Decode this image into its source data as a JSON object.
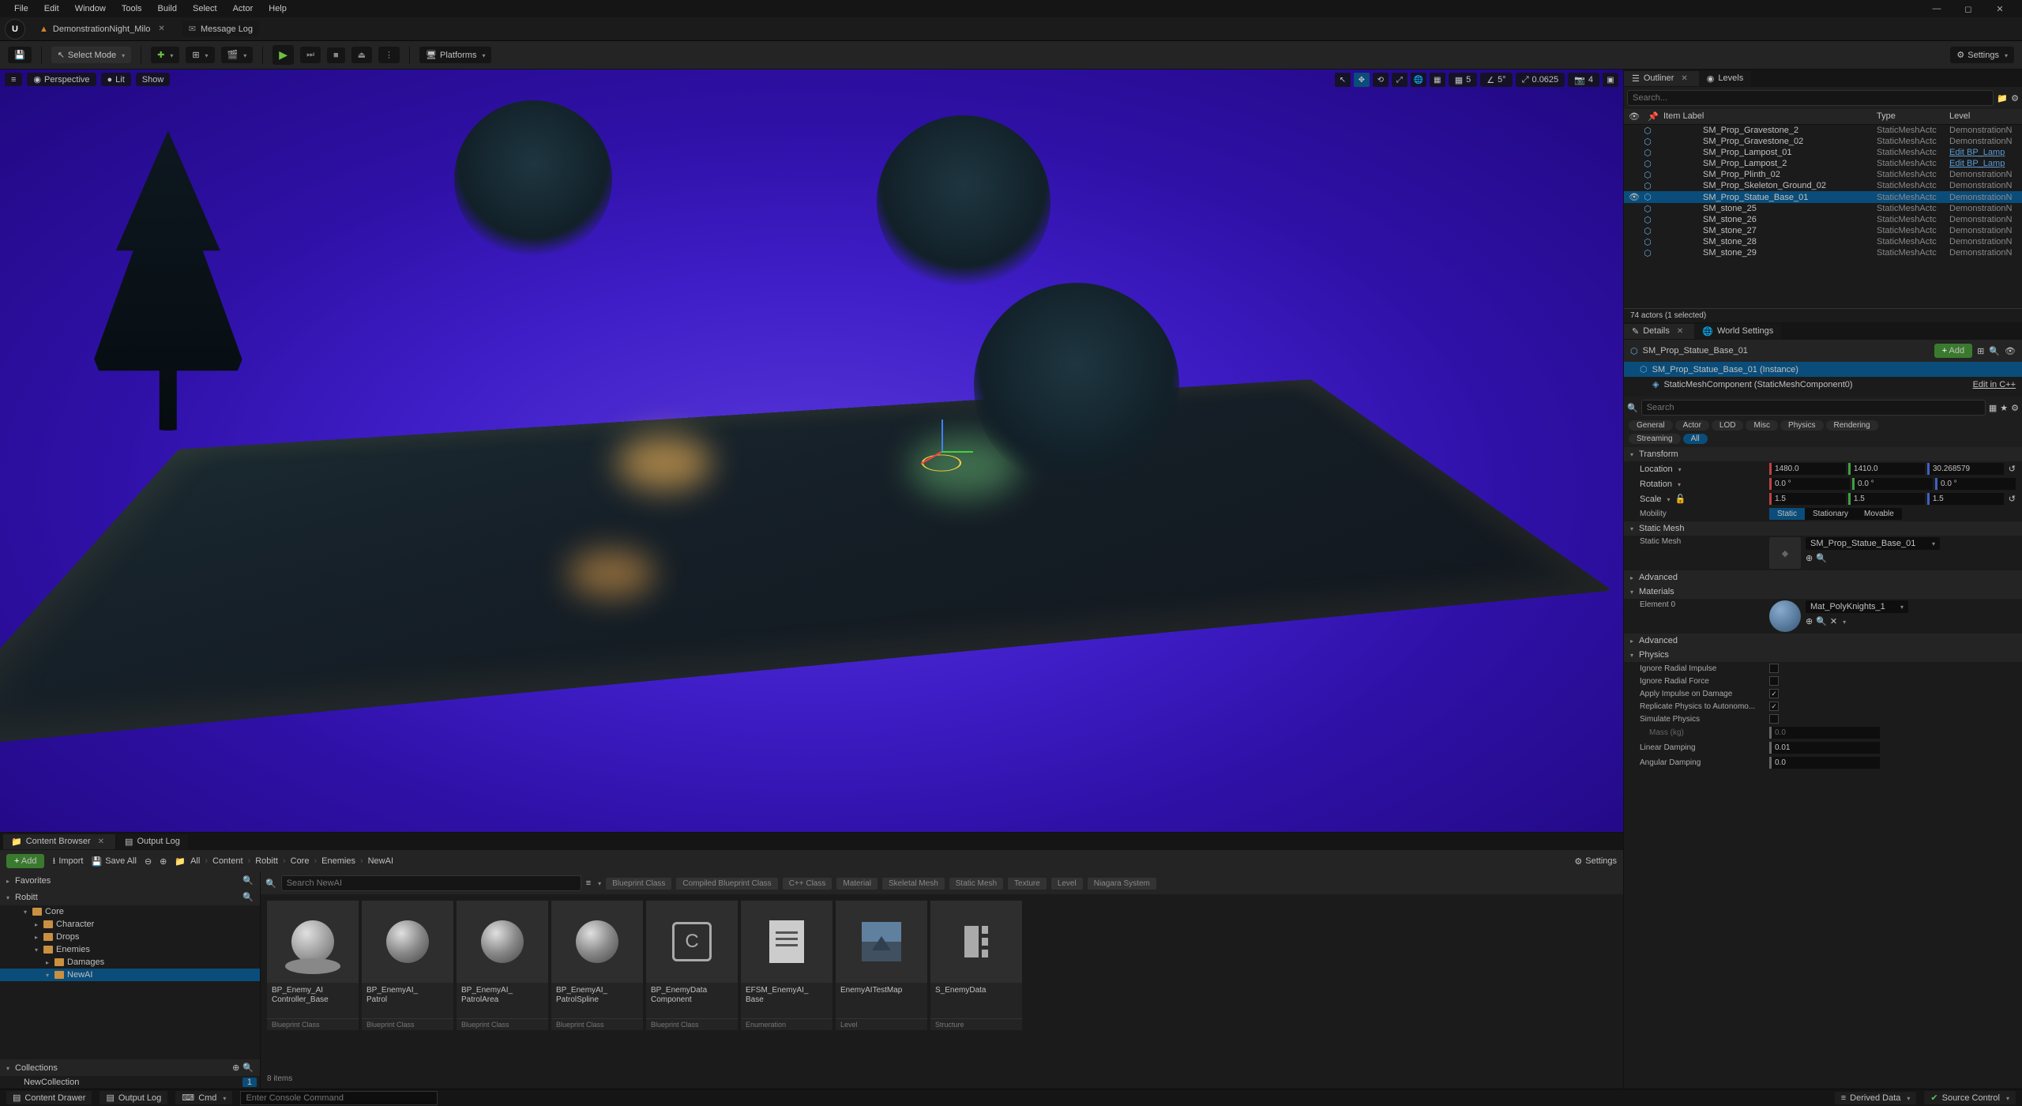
{
  "menu": [
    "File",
    "Edit",
    "Window",
    "Tools",
    "Build",
    "Select",
    "Actor",
    "Help"
  ],
  "level_tab": "DemonstrationNight_Milo",
  "msg_log_tab": "Message Log",
  "toolbar": {
    "select_mode": "Select Mode",
    "platforms": "Platforms",
    "settings": "Settings"
  },
  "viewport": {
    "menu_btn": "≡",
    "perspective": "Perspective",
    "lit": "Lit",
    "show": "Show",
    "snap_val": "5",
    "angle_val": "5°",
    "scale_val": "0.0625",
    "cam_val": "4"
  },
  "outliner": {
    "tab": "Outliner",
    "levels_tab": "Levels",
    "search_ph": "Search...",
    "cols": {
      "label": "Item Label",
      "type": "Type",
      "level": "Level"
    },
    "rows": [
      {
        "n": "SM_Prop_Gravestone_2",
        "t": "StaticMeshActc",
        "lv": "DemonstrationN"
      },
      {
        "n": "SM_Prop_Gravestone_02",
        "t": "StaticMeshActc",
        "lv": "DemonstrationN"
      },
      {
        "n": "SM_Prop_Lampost_01",
        "t": "StaticMeshActc",
        "lv": "Edit BP_Lamp",
        "link": true
      },
      {
        "n": "SM_Prop_Lampost_2",
        "t": "StaticMeshActc",
        "lv": "Edit BP_Lamp",
        "link": true
      },
      {
        "n": "SM_Prop_Plinth_02",
        "t": "StaticMeshActc",
        "lv": "DemonstrationN"
      },
      {
        "n": "SM_Prop_Skeleton_Ground_02",
        "t": "StaticMeshActc",
        "lv": "DemonstrationN"
      },
      {
        "n": "SM_Prop_Statue_Base_01",
        "t": "StaticMeshActc",
        "lv": "DemonstrationN",
        "sel": true
      },
      {
        "n": "SM_stone_25",
        "t": "StaticMeshActc",
        "lv": "DemonstrationN"
      },
      {
        "n": "SM_stone_26",
        "t": "StaticMeshActc",
        "lv": "DemonstrationN"
      },
      {
        "n": "SM_stone_27",
        "t": "StaticMeshActc",
        "lv": "DemonstrationN"
      },
      {
        "n": "SM_stone_28",
        "t": "StaticMeshActc",
        "lv": "DemonstrationN"
      },
      {
        "n": "SM_stone_29",
        "t": "StaticMeshActc",
        "lv": "DemonstrationN"
      }
    ],
    "status": "74 actors (1 selected)"
  },
  "details": {
    "tab": "Details",
    "world_tab": "World Settings",
    "actor": "SM_Prop_Statue_Base_01",
    "add": "Add",
    "instance": "SM_Prop_Statue_Base_01 (Instance)",
    "smc": "StaticMeshComponent (StaticMeshComponent0)",
    "edit_cpp": "Edit in C++",
    "search_ph": "Search",
    "filters": [
      "General",
      "Actor",
      "LOD",
      "Misc",
      "Physics",
      "Rendering"
    ],
    "filters2": [
      "Streaming",
      "All"
    ],
    "transform": {
      "title": "Transform",
      "loc_label": "Location",
      "loc": [
        "1480.0",
        "1410.0",
        "30.268579"
      ],
      "rot_label": "Rotation",
      "rot": [
        "0.0 °",
        "0.0 °",
        "0.0 °"
      ],
      "scl_label": "Scale",
      "scl": [
        "1.5",
        "1.5",
        "1.5"
      ],
      "mobility": "Mobility",
      "mob_opts": [
        "Static",
        "Stationary",
        "Movable"
      ]
    },
    "static_mesh": {
      "title": "Static Mesh",
      "label": "Static Mesh",
      "value": "SM_Prop_Statue_Base_01"
    },
    "advanced": "Advanced",
    "materials": {
      "title": "Materials",
      "el0": "Element 0",
      "value": "Mat_PolyKnights_1"
    },
    "physics": {
      "title": "Physics",
      "ignore_radial_impulse": "Ignore Radial Impulse",
      "ignore_radial_force": "Ignore Radial Force",
      "apply_impulse": "Apply Impulse on Damage",
      "replicate": "Replicate Physics to Autonomo...",
      "simulate": "Simulate Physics",
      "mass": "Mass (kg)",
      "mass_v": "0.0",
      "lin_damp": "Linear Damping",
      "lin_damp_v": "0.01",
      "ang_damp": "Angular Damping",
      "ang_damp_v": "0.0"
    }
  },
  "content_browser": {
    "tab": "Content Browser",
    "output_tab": "Output Log",
    "add": "Add",
    "import": "Import",
    "save_all": "Save All",
    "breadcrumb": [
      "All",
      "Content",
      "Robitt",
      "Core",
      "Enemies",
      "NewAI"
    ],
    "settings": "Settings",
    "favorites": "Favorites",
    "root": "Robitt",
    "tree": [
      {
        "n": "Core",
        "l": 1
      },
      {
        "n": "Character",
        "l": 2
      },
      {
        "n": "Drops",
        "l": 2
      },
      {
        "n": "Enemies",
        "l": 2
      },
      {
        "n": "Damages",
        "l": 3
      },
      {
        "n": "NewAI",
        "l": 3,
        "sel": true
      }
    ],
    "collections": "Collections",
    "new_collection": "NewCollection",
    "search_ph": "Search NewAI",
    "filter_chips": [
      "Blueprint Class",
      "Compiled Blueprint Class",
      "C++ Class",
      "Material",
      "Skeletal Mesh",
      "Static Mesh",
      "Texture",
      "Level",
      "Niagara System"
    ],
    "assets": [
      {
        "n": "BP_Enemy_AI\nController_Base",
        "t": "Blueprint Class",
        "ic": "pawn"
      },
      {
        "n": "BP_EnemyAI_\nPatrol",
        "t": "Blueprint Class",
        "ic": "sphere"
      },
      {
        "n": "BP_EnemyAI_\nPatrolArea",
        "t": "Blueprint Class",
        "ic": "sphere"
      },
      {
        "n": "BP_EnemyAI_\nPatrolSpline",
        "t": "Blueprint Class",
        "ic": "sphere"
      },
      {
        "n": "BP_EnemyData\nComponent",
        "t": "Blueprint Class",
        "ic": "comp"
      },
      {
        "n": "EFSM_EnemyAI_\nBase",
        "t": "Enumeration",
        "ic": "enum"
      },
      {
        "n": "EnemyAITestMap",
        "t": "Level",
        "ic": "level"
      },
      {
        "n": "S_EnemyData",
        "t": "Structure",
        "ic": "struct"
      }
    ],
    "status": "8 items"
  },
  "statusbar": {
    "content_drawer": "Content Drawer",
    "output_log": "Output Log",
    "cmd": "Cmd",
    "cmd_ph": "Enter Console Command",
    "derived": "Derived Data",
    "source": "Source Control"
  }
}
